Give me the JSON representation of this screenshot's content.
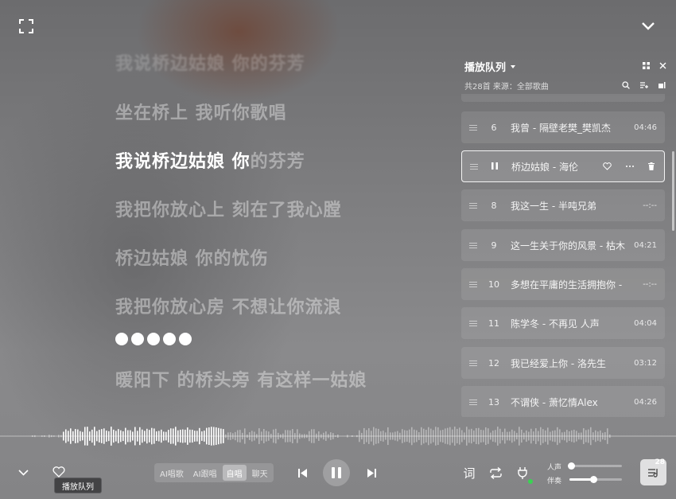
{
  "lyrics": {
    "top_faint": "我说桥边姑娘 你的芬芳",
    "line1": "坐在桥上 我听你歌唱",
    "current_sung": "我说桥边姑娘 你",
    "current_rest": "的芬芳",
    "line3": "我把你放心上 刻在了我心膛",
    "line4": "桥边姑娘 你的忧伤",
    "line5": "我把你放心房 不想让你流浪",
    "line7": "暖阳下 的桥头旁 有这样一姑娘"
  },
  "queue": {
    "title": "播放队列",
    "count": "共28首",
    "source": "来源：全部歌曲",
    "items": [
      {
        "num": "6",
        "title": "我曾 - 隔壁老樊_樊凯杰",
        "duration": "04:46"
      },
      {
        "num": "",
        "title": "桥边姑娘 - 海伦",
        "duration": ""
      },
      {
        "num": "8",
        "title": "我这一生 - 半吨兄弟",
        "duration": "--:--"
      },
      {
        "num": "9",
        "title": "这一生关于你的风景 - 枯木",
        "duration": "04:21"
      },
      {
        "num": "10",
        "title": "多想在平庸的生活拥抱你 - ",
        "duration": "--:--"
      },
      {
        "num": "11",
        "title": "陈学冬 - 不再见 人声",
        "duration": "04:04"
      },
      {
        "num": "12",
        "title": "我已经爱上你 - 洛先生",
        "duration": "03:12"
      },
      {
        "num": "13",
        "title": "不谓侠 - 萧忆情Alex",
        "duration": "04:26"
      }
    ]
  },
  "controls": {
    "modes": [
      "AI唱歌",
      "AI跟唱",
      "自唱",
      "聊天"
    ],
    "active_mode": "自唱",
    "tooltip": "播放队列",
    "lyrics_btn": "词",
    "vocal_label": "人声",
    "accomp_label": "伴奏",
    "vocal_level": 0.03,
    "accomp_level": 0.46,
    "queue_badge": "28"
  },
  "colors": {
    "accent_green": "#39d353"
  }
}
